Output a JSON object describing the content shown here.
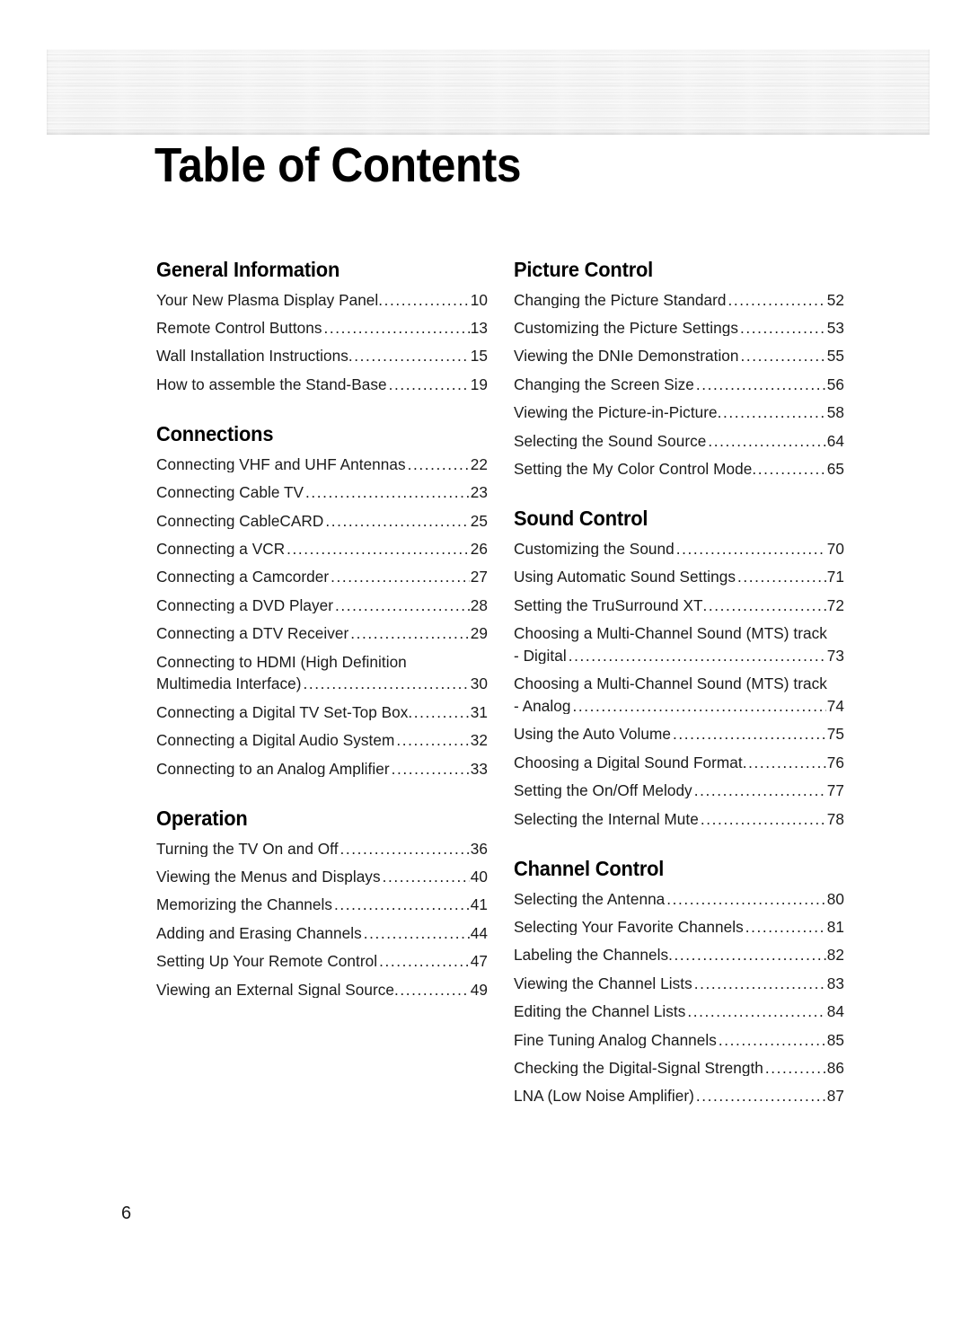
{
  "document": {
    "title": "Table of Contents",
    "folio": "6",
    "banner": {
      "style": "brushed-metal"
    },
    "colors": {
      "text": "#1a1a1a",
      "heading": "#000000",
      "background": "#ffffff"
    }
  },
  "columns": {
    "left": [
      {
        "heading": "General Information",
        "entries": [
          {
            "label": "Your New Plasma Display Panel",
            "page": "10",
            "gapless": true
          },
          {
            "label": "Remote Control Buttons",
            "page": "13"
          },
          {
            "label": "Wall Installation Instructions",
            "page": "15",
            "gapless": true
          },
          {
            "label": "How to assemble the Stand-Base",
            "page": "19"
          }
        ]
      },
      {
        "heading": "Connections",
        "entries": [
          {
            "label": "Connecting VHF and UHF Antennas",
            "page": "22"
          },
          {
            "label": "Connecting Cable TV",
            "page": "23"
          },
          {
            "label": "Connecting CableCARD",
            "page": "25"
          },
          {
            "label": "Connecting a VCR",
            "page": "26"
          },
          {
            "label": "Connecting a Camcorder",
            "page": "27"
          },
          {
            "label": "Connecting a DVD Player",
            "page": "28"
          },
          {
            "label": "Connecting a DTV Receiver",
            "page": "29"
          },
          {
            "label": "Connecting to HDMI (High Definition",
            "label2": "Multimedia Interface)",
            "page": "30"
          },
          {
            "label": "Connecting a Digital TV Set-Top Box",
            "page": "31",
            "gapless": true
          },
          {
            "label": "Connecting a Digital Audio System",
            "page": "32"
          },
          {
            "label": "Connecting to an Analog Amplifier",
            "page": "33"
          }
        ]
      },
      {
        "heading": "Operation",
        "entries": [
          {
            "label": "Turning the TV On and Off",
            "page": "36"
          },
          {
            "label": "Viewing the Menus and Displays",
            "page": "40"
          },
          {
            "label": "Memorizing the Channels",
            "page": "41"
          },
          {
            "label": "Adding and Erasing Channels",
            "page": "44"
          },
          {
            "label": "Setting Up Your Remote Control",
            "page": "47"
          },
          {
            "label": "Viewing an External Signal Source",
            "page": "49",
            "gapless": true
          }
        ]
      }
    ],
    "right": [
      {
        "heading": "Picture Control",
        "entries": [
          {
            "label": "Changing the Picture Standard",
            "page": "52"
          },
          {
            "label": "Customizing the Picture Settings",
            "page": "53"
          },
          {
            "label": "Viewing the DNIe Demonstration",
            "page": "55"
          },
          {
            "label": "Changing the Screen Size",
            "page": "56"
          },
          {
            "label": "Viewing the Picture-in-Picture",
            "page": "58",
            "gapless": true
          },
          {
            "label": "Selecting the Sound Source",
            "page": "64"
          },
          {
            "label": "Setting the My Color Control Mode",
            "page": "65",
            "gapless": true
          }
        ]
      },
      {
        "heading": "Sound Control",
        "entries": [
          {
            "label": "Customizing the Sound",
            "page": "70"
          },
          {
            "label": "Using Automatic Sound Settings",
            "page": "71"
          },
          {
            "label": "Setting the TruSurround XT",
            "page": "72",
            "gapless": true
          },
          {
            "label": "Choosing a Multi-Channel Sound (MTS) track",
            "label2": "- Digital",
            "page": "73"
          },
          {
            "label": "Choosing a Multi-Channel Sound (MTS) track",
            "label2": "- Analog",
            "page": "74"
          },
          {
            "label": "Using the Auto Volume",
            "page": "75"
          },
          {
            "label": "Choosing a Digital Sound Format",
            "page": "76",
            "gapless": true
          },
          {
            "label": "Setting the On/Off Melody",
            "page": "77"
          },
          {
            "label": "Selecting the Internal Mute",
            "page": "78"
          }
        ]
      },
      {
        "heading": "Channel Control",
        "entries": [
          {
            "label": "Selecting the Antenna",
            "page": "80"
          },
          {
            "label": "Selecting Your Favorite Channels",
            "page": "81"
          },
          {
            "label": "Labeling the Channels",
            "page": "82",
            "gapless": true
          },
          {
            "label": "Viewing the Channel Lists",
            "page": "83"
          },
          {
            "label": "Editing the Channel Lists",
            "page": "84"
          },
          {
            "label": "Fine Tuning Analog Channels",
            "page": "85"
          },
          {
            "label": "Checking the Digital-Signal Strength",
            "page": "86"
          },
          {
            "label": "LNA (Low Noise Amplifier)",
            "page": "87"
          }
        ]
      }
    ]
  }
}
